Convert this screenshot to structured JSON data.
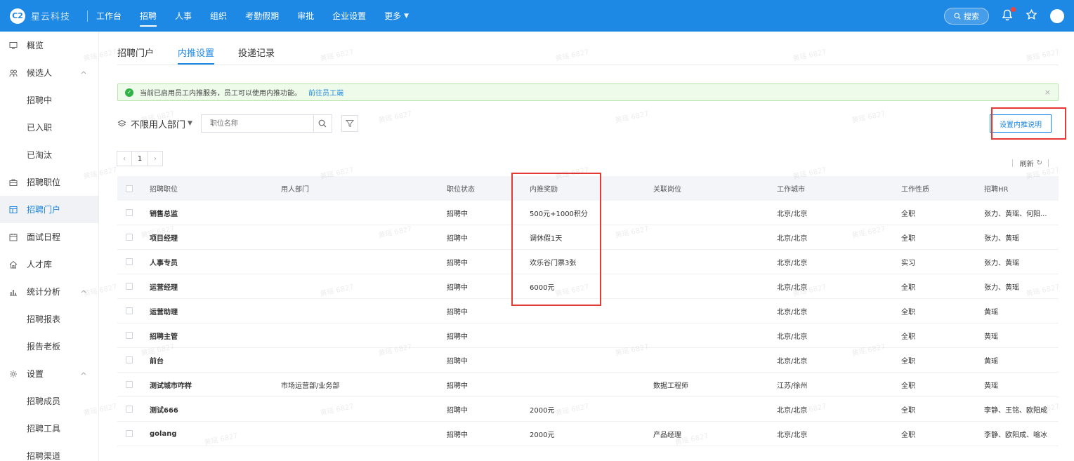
{
  "app": {
    "logo_mark": "C2",
    "company_name": "星云科技"
  },
  "topnav": {
    "items": [
      {
        "label": "工作台"
      },
      {
        "label": "招聘"
      },
      {
        "label": "人事"
      },
      {
        "label": "组织"
      },
      {
        "label": "考勤假期"
      },
      {
        "label": "审批"
      },
      {
        "label": "企业设置"
      },
      {
        "label": "更多"
      }
    ],
    "active": "招聘",
    "search_label": "搜索"
  },
  "sidebar": {
    "items": [
      {
        "label": "概览",
        "icon": "monitor-icon",
        "level": 1
      },
      {
        "label": "候选人",
        "icon": "people-icon",
        "level": 1,
        "expanded": true
      },
      {
        "label": "招聘中",
        "level": 2
      },
      {
        "label": "已入职",
        "level": 2
      },
      {
        "label": "已淘汰",
        "level": 2
      },
      {
        "label": "招聘职位",
        "icon": "briefcase-icon",
        "level": 1
      },
      {
        "label": "招聘门户",
        "icon": "portal-icon",
        "level": 1,
        "active": true
      },
      {
        "label": "面试日程",
        "icon": "calendar-icon",
        "level": 1
      },
      {
        "label": "人才库",
        "icon": "home-icon",
        "level": 1
      },
      {
        "label": "统计分析",
        "icon": "bar-chart-icon",
        "level": 1,
        "expanded": true
      },
      {
        "label": "招聘报表",
        "level": 2
      },
      {
        "label": "报告老板",
        "level": 2
      },
      {
        "label": "设置",
        "icon": "gear-icon",
        "level": 1,
        "expanded": true
      },
      {
        "label": "招聘成员",
        "level": 2
      },
      {
        "label": "招聘工具",
        "level": 2
      },
      {
        "label": "招聘渠道",
        "level": 2
      }
    ]
  },
  "tabs": [
    {
      "label": "招聘门户"
    },
    {
      "label": "内推设置",
      "active": true
    },
    {
      "label": "投递记录"
    }
  ],
  "alert": {
    "message": "当前已启用员工内推服务，员工可以使用内推功能。",
    "link": "前往员工端",
    "close": "×"
  },
  "filters": {
    "dept_label": "不限用人部门",
    "search_placeholder": "职位名称",
    "intro_button": "设置内推说明"
  },
  "pager": {
    "prev": "‹",
    "page": "1",
    "next": "›"
  },
  "refresh_label": "刷新",
  "watermark": "黄瑶 6827",
  "table": {
    "headers": [
      "招聘职位",
      "用人部门",
      "职位状态",
      "内推奖励",
      "关联岗位",
      "工作城市",
      "工作性质",
      "招聘HR"
    ],
    "rows": [
      [
        "销售总监",
        "",
        "招聘中",
        "500元+1000积分",
        "",
        "北京/北京",
        "全职",
        "张力、黄瑶、何阳..."
      ],
      [
        "项目经理",
        "",
        "招聘中",
        "调休假1天",
        "",
        "北京/北京",
        "全职",
        "张力、黄瑶"
      ],
      [
        "人事专员",
        "",
        "招聘中",
        "欢乐谷门票3张",
        "",
        "北京/北京",
        "实习",
        "张力、黄瑶"
      ],
      [
        "运营经理",
        "",
        "招聘中",
        "6000元",
        "",
        "北京/北京",
        "全职",
        "张力、黄瑶"
      ],
      [
        "运营助理",
        "",
        "招聘中",
        "",
        "",
        "北京/北京",
        "全职",
        "黄瑶"
      ],
      [
        "招聘主管",
        "",
        "招聘中",
        "",
        "",
        "北京/北京",
        "全职",
        "黄瑶"
      ],
      [
        "前台",
        "",
        "招聘中",
        "",
        "",
        "北京/北京",
        "全职",
        "黄瑶"
      ],
      [
        "测试城市咋样",
        "市场运营部/业务部",
        "招聘中",
        "",
        "数据工程师",
        "江苏/徐州",
        "全职",
        "黄瑶"
      ],
      [
        "测试666",
        "",
        "招聘中",
        "2000元",
        "",
        "北京/北京",
        "全职",
        "李静、王铭、欧阳成"
      ],
      [
        "golang",
        "",
        "招聘中",
        "2000元",
        "产品经理",
        "北京/北京",
        "全职",
        "李静、欧阳成、喻冰"
      ]
    ]
  },
  "colors": {
    "primary": "#1e88e5",
    "highlight": "#e53935",
    "success": "#2fb344"
  }
}
